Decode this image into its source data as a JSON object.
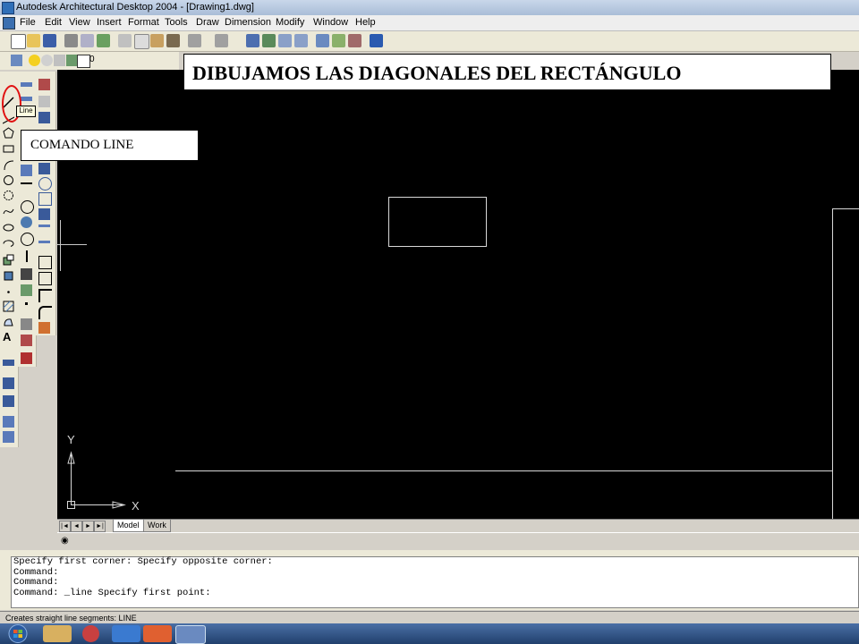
{
  "window": {
    "title": "Autodesk Architectural Desktop 2004 - [Drawing1.dwg]"
  },
  "menu": {
    "items": [
      "File",
      "Edit",
      "View",
      "Insert",
      "Format",
      "Tools",
      "Draw",
      "Dimension",
      "Modify",
      "Window",
      "Help"
    ]
  },
  "layer": {
    "name": "0"
  },
  "annotations": {
    "banner": "DIBUJAMOS LAS DIAGONALES DEL RECTÁNGULO",
    "command_label": "COMANDO  LINE"
  },
  "tooltip": {
    "text": "Line"
  },
  "ucs": {
    "x_label": "X",
    "y_label": "Y"
  },
  "tabs": {
    "model": "Model",
    "work": "Work"
  },
  "command_lines": [
    "Specify first corner: Specify opposite corner:",
    "Command:",
    "Command:",
    "",
    "Command: _line Specify first point:"
  ],
  "status": {
    "text": "Creates straight line segments:  LINE"
  },
  "colors": {
    "canvas": "#000000",
    "highlight": "#e01010"
  },
  "icons": {
    "draw_toolbar": [
      "line-icon",
      "construction-line-icon",
      "polygon-icon",
      "rectangle-icon",
      "arc-icon",
      "circle-icon",
      "revision-cloud-icon",
      "spline-icon",
      "ellipse-icon",
      "ellipse-arc-icon",
      "insert-block-icon",
      "make-block-icon",
      "point-icon",
      "hatch-icon",
      "region-icon",
      "multiline-text-icon"
    ]
  }
}
